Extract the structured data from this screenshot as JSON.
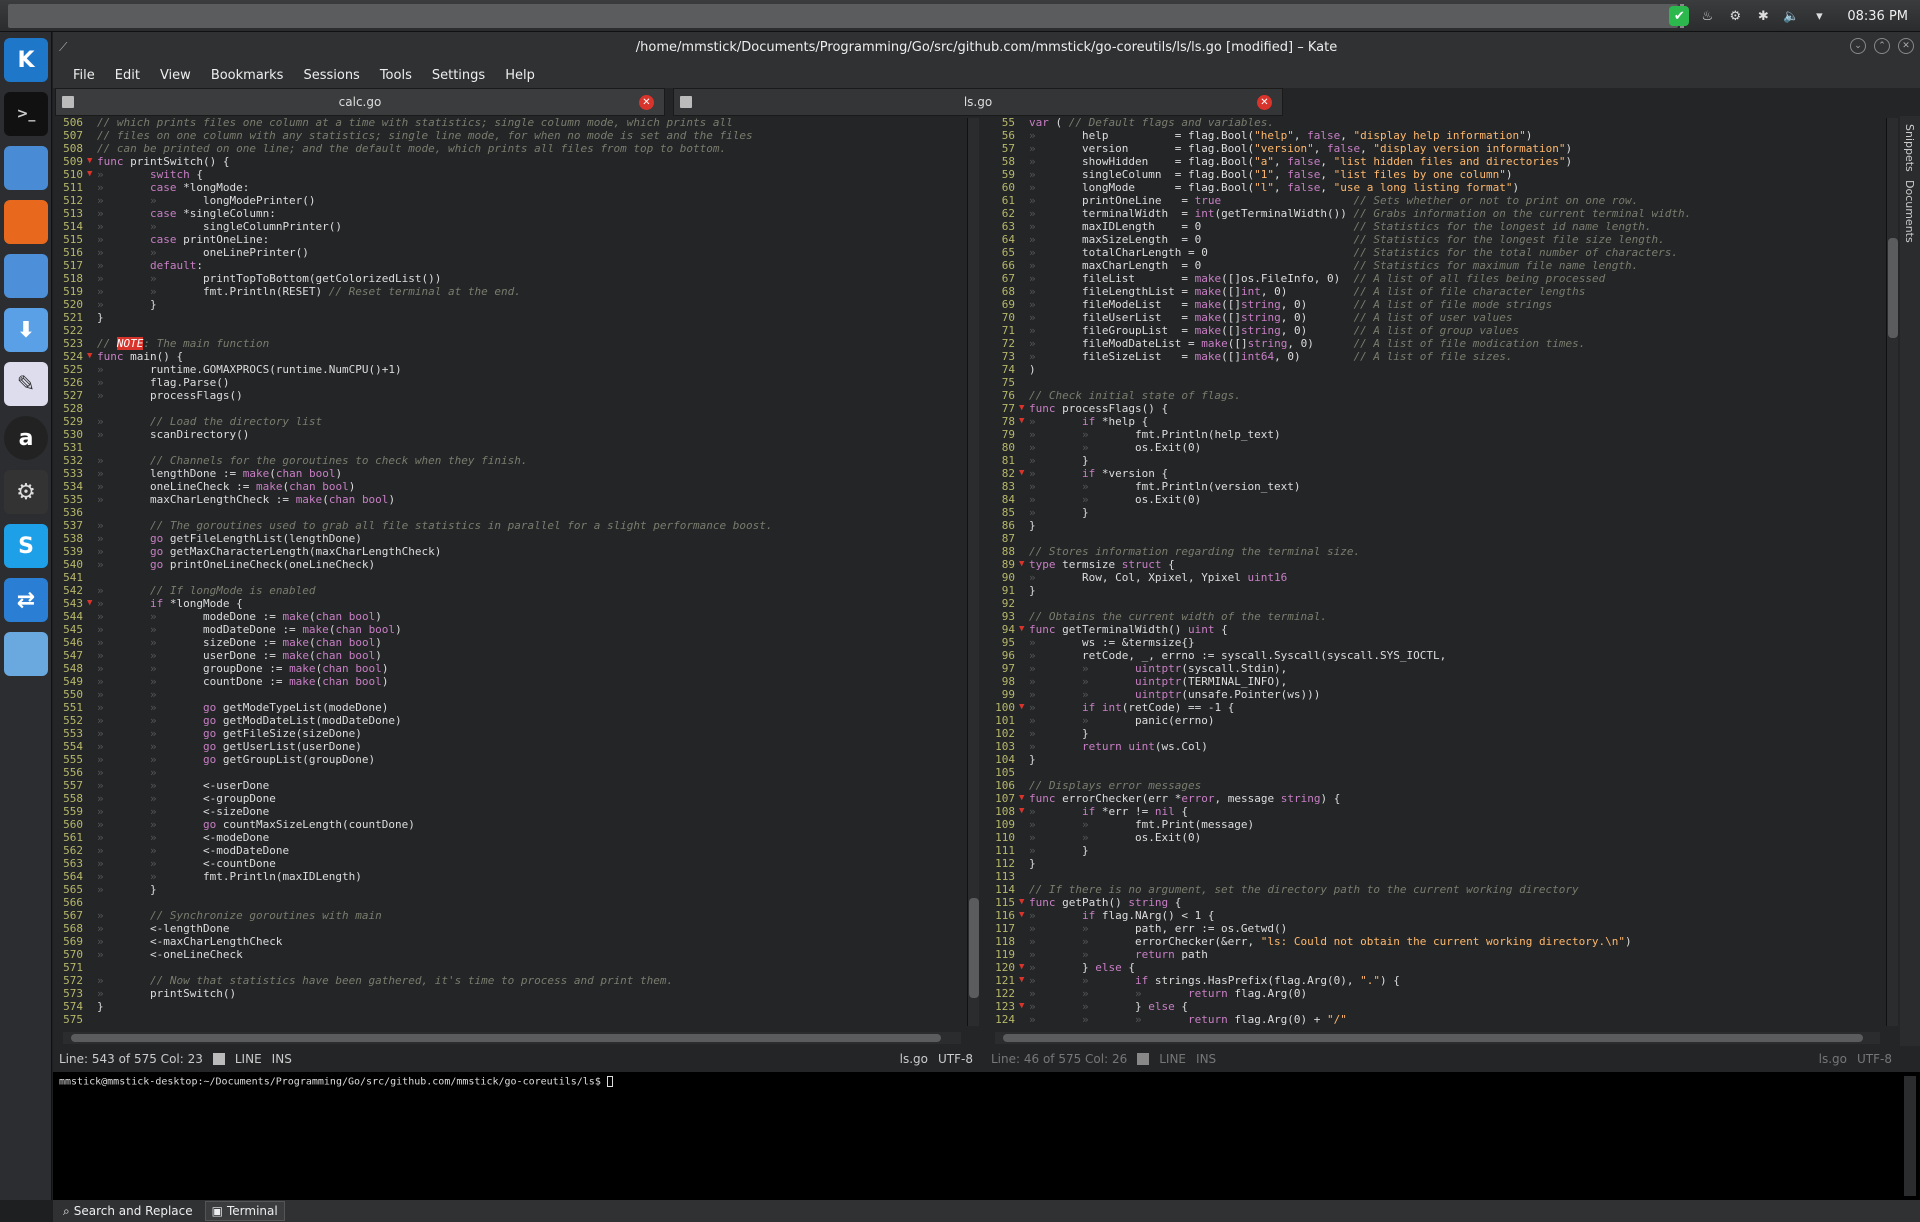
{
  "window_title": "/home/mmstick/Documents/Programming/Go/src/github.com/mmstick/go-coreutils/ls/ls.go [modified] – Kate",
  "clock": "08:36 PM",
  "menu": [
    "File",
    "Edit",
    "View",
    "Bookmarks",
    "Sessions",
    "Tools",
    "Settings",
    "Help"
  ],
  "tabs": [
    {
      "label": "calc.go"
    },
    {
      "label": "ls.go"
    }
  ],
  "side_tabs": [
    "Snippets",
    "Documents"
  ],
  "left_pane": {
    "lines": [
      {
        "n": "506",
        "f": "",
        "t": "// which prints files one column at a time with statistics; single column mode, which prints all"
      },
      {
        "n": "507",
        "f": "",
        "t": "// files on one column with any statistics; single line mode, for when no mode is set and the files"
      },
      {
        "n": "508",
        "f": "",
        "t": "// can be printed on one line; and the default mode, which prints all files from top to bottom."
      },
      {
        "n": "509",
        "f": "▼",
        "t": "func printSwitch() {"
      },
      {
        "n": "510",
        "f": "▼",
        "t": "»       switch {"
      },
      {
        "n": "511",
        "f": "",
        "t": "»       case *longMode:"
      },
      {
        "n": "512",
        "f": "",
        "t": "»       »       longModePrinter()"
      },
      {
        "n": "513",
        "f": "",
        "t": "»       case *singleColumn:"
      },
      {
        "n": "514",
        "f": "",
        "t": "»       »       singleColumnPrinter()"
      },
      {
        "n": "515",
        "f": "",
        "t": "»       case printOneLine:"
      },
      {
        "n": "516",
        "f": "",
        "t": "»       »       oneLinePrinter()"
      },
      {
        "n": "517",
        "f": "",
        "t": "»       default:"
      },
      {
        "n": "518",
        "f": "",
        "t": "»       »       printTopToBottom(getColorizedList())"
      },
      {
        "n": "519",
        "f": "",
        "t": "»       »       fmt.Println(RESET) // Reset terminal at the end."
      },
      {
        "n": "520",
        "f": "",
        "t": "»       }"
      },
      {
        "n": "521",
        "f": "",
        "t": "}"
      },
      {
        "n": "522",
        "f": "",
        "t": ""
      },
      {
        "n": "523",
        "f": "",
        "t": "// NOTE: The main function"
      },
      {
        "n": "524",
        "f": "▼",
        "t": "func main() {"
      },
      {
        "n": "525",
        "f": "",
        "t": "»       runtime.GOMAXPROCS(runtime.NumCPU()+1)"
      },
      {
        "n": "526",
        "f": "",
        "t": "»       flag.Parse()"
      },
      {
        "n": "527",
        "f": "",
        "t": "»       processFlags()"
      },
      {
        "n": "528",
        "f": "",
        "t": ""
      },
      {
        "n": "529",
        "f": "",
        "t": "»       // Load the directory list"
      },
      {
        "n": "530",
        "f": "",
        "t": "»       scanDirectory()"
      },
      {
        "n": "531",
        "f": "",
        "t": ""
      },
      {
        "n": "532",
        "f": "",
        "t": "»       // Channels for the goroutines to check when they finish."
      },
      {
        "n": "533",
        "f": "",
        "t": "»       lengthDone := make(chan bool)"
      },
      {
        "n": "534",
        "f": "",
        "t": "»       oneLineCheck := make(chan bool)"
      },
      {
        "n": "535",
        "f": "",
        "t": "»       maxCharLengthCheck := make(chan bool)"
      },
      {
        "n": "536",
        "f": "",
        "t": ""
      },
      {
        "n": "537",
        "f": "",
        "t": "»       // The goroutines used to grab all file statistics in parallel for a slight performance boost."
      },
      {
        "n": "538",
        "f": "",
        "t": "»       go getFileLengthList(lengthDone)"
      },
      {
        "n": "539",
        "f": "",
        "t": "»       go getMaxCharacterLength(maxCharLengthCheck)"
      },
      {
        "n": "540",
        "f": "",
        "t": "»       go printOneLineCheck(oneLineCheck)"
      },
      {
        "n": "541",
        "f": "",
        "t": ""
      },
      {
        "n": "542",
        "f": "",
        "t": "»       // If longMode is enabled"
      },
      {
        "n": "543",
        "f": "▼",
        "t": "»       if *longMode {"
      },
      {
        "n": "544",
        "f": "",
        "t": "»       »       modeDone := make(chan bool)"
      },
      {
        "n": "545",
        "f": "",
        "t": "»       »       modDateDone := make(chan bool)"
      },
      {
        "n": "546",
        "f": "",
        "t": "»       »       sizeDone := make(chan bool)"
      },
      {
        "n": "547",
        "f": "",
        "t": "»       »       userDone := make(chan bool)"
      },
      {
        "n": "548",
        "f": "",
        "t": "»       »       groupDone := make(chan bool)"
      },
      {
        "n": "549",
        "f": "",
        "t": "»       »       countDone := make(chan bool)"
      },
      {
        "n": "550",
        "f": "",
        "t": "»       »"
      },
      {
        "n": "551",
        "f": "",
        "t": "»       »       go getModeTypeList(modeDone)"
      },
      {
        "n": "552",
        "f": "",
        "t": "»       »       go getModDateList(modDateDone)"
      },
      {
        "n": "553",
        "f": "",
        "t": "»       »       go getFileSize(sizeDone)"
      },
      {
        "n": "554",
        "f": "",
        "t": "»       »       go getUserList(userDone)"
      },
      {
        "n": "555",
        "f": "",
        "t": "»       »       go getGroupList(groupDone)"
      },
      {
        "n": "556",
        "f": "",
        "t": "»       »"
      },
      {
        "n": "557",
        "f": "",
        "t": "»       »       <-userDone"
      },
      {
        "n": "558",
        "f": "",
        "t": "»       »       <-groupDone"
      },
      {
        "n": "559",
        "f": "",
        "t": "»       »       <-sizeDone"
      },
      {
        "n": "560",
        "f": "",
        "t": "»       »       go countMaxSizeLength(countDone)"
      },
      {
        "n": "561",
        "f": "",
        "t": "»       »       <-modeDone"
      },
      {
        "n": "562",
        "f": "",
        "t": "»       »       <-modDateDone"
      },
      {
        "n": "563",
        "f": "",
        "t": "»       »       <-countDone"
      },
      {
        "n": "564",
        "f": "",
        "t": "»       »       fmt.Println(maxIDLength)"
      },
      {
        "n": "565",
        "f": "",
        "t": "»       }"
      },
      {
        "n": "566",
        "f": "",
        "t": ""
      },
      {
        "n": "567",
        "f": "",
        "t": "»       // Synchronize goroutines with main"
      },
      {
        "n": "568",
        "f": "",
        "t": "»       <-lengthDone"
      },
      {
        "n": "569",
        "f": "",
        "t": "»       <-maxCharLengthCheck"
      },
      {
        "n": "570",
        "f": "",
        "t": "»       <-oneLineCheck"
      },
      {
        "n": "571",
        "f": "",
        "t": ""
      },
      {
        "n": "572",
        "f": "",
        "t": "»       // Now that statistics have been gathered, it's time to process and print them."
      },
      {
        "n": "573",
        "f": "",
        "t": "»       printSwitch()"
      },
      {
        "n": "574",
        "f": "",
        "t": "}"
      },
      {
        "n": "575",
        "f": "",
        "t": ""
      }
    ],
    "status": {
      "position": "Line: 543 of 575 Col: 23",
      "mode1": "LINE",
      "mode2": "INS",
      "file": "ls.go",
      "encoding": "UTF-8"
    }
  },
  "right_pane": {
    "lines": [
      {
        "n": "55",
        "f": "",
        "t": "var ( // Default flags and variables."
      },
      {
        "n": "56",
        "f": "",
        "t": "»       help          = flag.Bool(\"help\", false, \"display help information\")"
      },
      {
        "n": "57",
        "f": "",
        "t": "»       version       = flag.Bool(\"version\", false, \"display version information\")"
      },
      {
        "n": "58",
        "f": "",
        "t": "»       showHidden    = flag.Bool(\"a\", false, \"list hidden files and directories\")"
      },
      {
        "n": "59",
        "f": "",
        "t": "»       singleColumn  = flag.Bool(\"1\", false, \"list files by one column\")"
      },
      {
        "n": "60",
        "f": "",
        "t": "»       longMode      = flag.Bool(\"l\", false, \"use a long listing format\")"
      },
      {
        "n": "61",
        "f": "",
        "t": "»       printOneLine   = true                    // Sets whether or not to print on one row."
      },
      {
        "n": "62",
        "f": "",
        "t": "»       terminalWidth  = int(getTerminalWidth()) // Grabs information on the current terminal width."
      },
      {
        "n": "63",
        "f": "",
        "t": "»       maxIDLength    = 0                       // Statistics for the longest id name length."
      },
      {
        "n": "64",
        "f": "",
        "t": "»       maxSizeLength  = 0                       // Statistics for the longest file size length."
      },
      {
        "n": "65",
        "f": "",
        "t": "»       totalCharLength = 0                      // Statistics for the total number of characters."
      },
      {
        "n": "66",
        "f": "",
        "t": "»       maxCharLength  = 0                       // Statistics for maximum file name length."
      },
      {
        "n": "67",
        "f": "",
        "t": "»       fileList       = make([]os.FileInfo, 0)  // A list of all files being processed"
      },
      {
        "n": "68",
        "f": "",
        "t": "»       fileLengthList = make([]int, 0)          // A list of file character lengths"
      },
      {
        "n": "69",
        "f": "",
        "t": "»       fileModeList   = make([]string, 0)       // A list of file mode strings"
      },
      {
        "n": "70",
        "f": "",
        "t": "»       fileUserList   = make([]string, 0)       // A list of user values"
      },
      {
        "n": "71",
        "f": "",
        "t": "»       fileGroupList  = make([]string, 0)       // A list of group values"
      },
      {
        "n": "72",
        "f": "",
        "t": "»       fileModDateList = make([]string, 0)      // A list of file modication times."
      },
      {
        "n": "73",
        "f": "",
        "t": "»       fileSizeList   = make([]int64, 0)        // A list of file sizes."
      },
      {
        "n": "74",
        "f": "",
        "t": ")"
      },
      {
        "n": "75",
        "f": "",
        "t": ""
      },
      {
        "n": "76",
        "f": "",
        "t": "// Check initial state of flags."
      },
      {
        "n": "77",
        "f": "▼",
        "t": "func processFlags() {"
      },
      {
        "n": "78",
        "f": "▼",
        "t": "»       if *help {"
      },
      {
        "n": "79",
        "f": "",
        "t": "»       »       fmt.Println(help_text)"
      },
      {
        "n": "80",
        "f": "",
        "t": "»       »       os.Exit(0)"
      },
      {
        "n": "81",
        "f": "",
        "t": "»       }"
      },
      {
        "n": "82",
        "f": "▼",
        "t": "»       if *version {"
      },
      {
        "n": "83",
        "f": "",
        "t": "»       »       fmt.Println(version_text)"
      },
      {
        "n": "84",
        "f": "",
        "t": "»       »       os.Exit(0)"
      },
      {
        "n": "85",
        "f": "",
        "t": "»       }"
      },
      {
        "n": "86",
        "f": "",
        "t": "}"
      },
      {
        "n": "87",
        "f": "",
        "t": ""
      },
      {
        "n": "88",
        "f": "",
        "t": "// Stores information regarding the terminal size."
      },
      {
        "n": "89",
        "f": "▼",
        "t": "type termsize struct {"
      },
      {
        "n": "90",
        "f": "",
        "t": "»       Row, Col, Xpixel, Ypixel uint16"
      },
      {
        "n": "91",
        "f": "",
        "t": "}"
      },
      {
        "n": "92",
        "f": "",
        "t": ""
      },
      {
        "n": "93",
        "f": "",
        "t": "// Obtains the current width of the terminal."
      },
      {
        "n": "94",
        "f": "▼",
        "t": "func getTerminalWidth() uint {"
      },
      {
        "n": "95",
        "f": "",
        "t": "»       ws := &termsize{}"
      },
      {
        "n": "96",
        "f": "",
        "t": "»       retCode, _, errno := syscall.Syscall(syscall.SYS_IOCTL,"
      },
      {
        "n": "97",
        "f": "",
        "t": "»       »       uintptr(syscall.Stdin),"
      },
      {
        "n": "98",
        "f": "",
        "t": "»       »       uintptr(TERMINAL_INFO),"
      },
      {
        "n": "99",
        "f": "",
        "t": "»       »       uintptr(unsafe.Pointer(ws)))"
      },
      {
        "n": "100",
        "f": "▼",
        "t": "»       if int(retCode) == -1 {"
      },
      {
        "n": "101",
        "f": "",
        "t": "»       »       panic(errno)"
      },
      {
        "n": "102",
        "f": "",
        "t": "»       }"
      },
      {
        "n": "103",
        "f": "",
        "t": "»       return uint(ws.Col)"
      },
      {
        "n": "104",
        "f": "",
        "t": "}"
      },
      {
        "n": "105",
        "f": "",
        "t": ""
      },
      {
        "n": "106",
        "f": "",
        "t": "// Displays error messages"
      },
      {
        "n": "107",
        "f": "▼",
        "t": "func errorChecker(err *error, message string) {"
      },
      {
        "n": "108",
        "f": "▼",
        "t": "»       if *err != nil {"
      },
      {
        "n": "109",
        "f": "",
        "t": "»       »       fmt.Print(message)"
      },
      {
        "n": "110",
        "f": "",
        "t": "»       »       os.Exit(0)"
      },
      {
        "n": "111",
        "f": "",
        "t": "»       }"
      },
      {
        "n": "112",
        "f": "",
        "t": "}"
      },
      {
        "n": "113",
        "f": "",
        "t": ""
      },
      {
        "n": "114",
        "f": "",
        "t": "// If there is no argument, set the directory path to the current working directory"
      },
      {
        "n": "115",
        "f": "▼",
        "t": "func getPath() string {"
      },
      {
        "n": "116",
        "f": "▼",
        "t": "»       if flag.NArg() < 1 {"
      },
      {
        "n": "117",
        "f": "",
        "t": "»       »       path, err := os.Getwd()"
      },
      {
        "n": "118",
        "f": "",
        "t": "»       »       errorChecker(&err, \"ls: Could not obtain the current working directory.\\n\")"
      },
      {
        "n": "119",
        "f": "",
        "t": "»       »       return path"
      },
      {
        "n": "120",
        "f": "▼",
        "t": "»       } else {"
      },
      {
        "n": "121",
        "f": "▼",
        "t": "»       »       if strings.HasPrefix(flag.Arg(0), \".\") {"
      },
      {
        "n": "122",
        "f": "",
        "t": "»       »       »       return flag.Arg(0)"
      },
      {
        "n": "123",
        "f": "▼",
        "t": "»       »       } else {"
      },
      {
        "n": "124",
        "f": "",
        "t": "»       »       »       return flag.Arg(0) + \"/\""
      }
    ],
    "status": {
      "position": "Line: 46 of 575 Col: 26",
      "mode1": "LINE",
      "mode2": "INS",
      "file": "ls.go",
      "encoding": "UTF-8"
    }
  },
  "terminal": {
    "prompt": "mmstick@mmstick-desktop:~/Documents/Programming/Go/src/github.com/mmstick/go-coreutils/ls$ "
  },
  "bottom_tabs": [
    {
      "label": "Search and Replace",
      "active": false
    },
    {
      "label": "Terminal",
      "active": true
    }
  ],
  "colors": {
    "comment": "#7a7c6e",
    "keyword": "#c87fc4",
    "string": "#ffb86c",
    "number": "#b7b86a",
    "accent": "#d9342b"
  }
}
